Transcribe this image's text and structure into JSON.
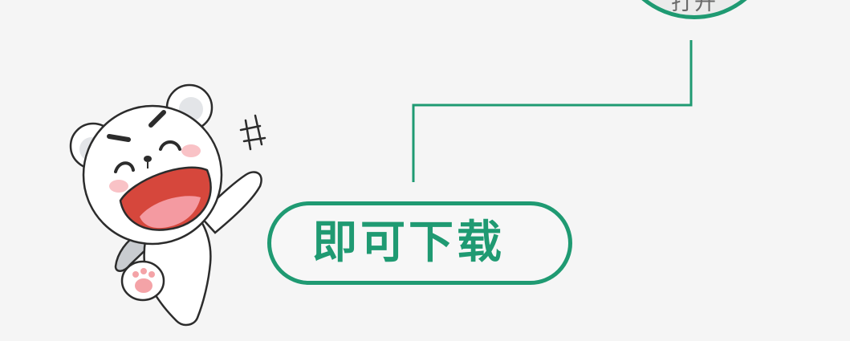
{
  "top_circle": {
    "label": "打开"
  },
  "download_button": {
    "label": "即可下载"
  },
  "colors": {
    "accent": "#1f9a72",
    "background": "#f5f5f5"
  },
  "icons": {
    "mascot": "bear-mascot-icon"
  }
}
